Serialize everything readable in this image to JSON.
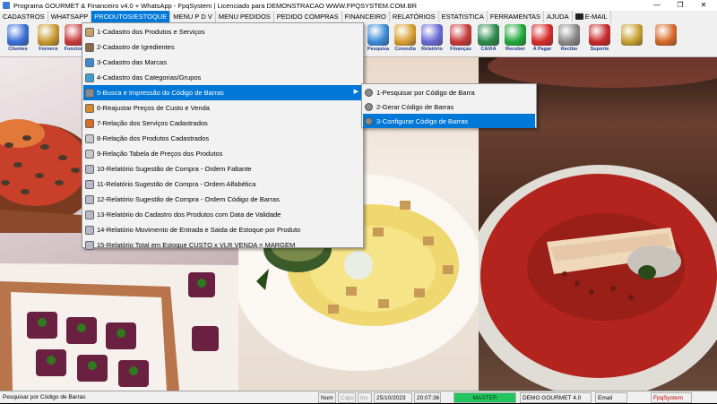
{
  "window": {
    "title": "Programa GOURMET & Financeiro v4.0 + WhatsApp - FpqSystem | Licenciado para  DEMONSTRACAO WWW.FPQSYSTEM.COM.BR",
    "minimize": "—",
    "restore": "❐",
    "close": "✕"
  },
  "menubar": [
    {
      "label": "CADASTROS"
    },
    {
      "label": "WHATSAPP"
    },
    {
      "label": "PRODUTOS/ESTOQUE",
      "active": true
    },
    {
      "label": "MENU P D V"
    },
    {
      "label": "MENU PEDIDOS"
    },
    {
      "label": "PEDIDO COMPRAS"
    },
    {
      "label": "FINANCEIRO"
    },
    {
      "label": "RELATÓRIOS"
    },
    {
      "label": "ESTATISTICA"
    },
    {
      "label": "FERRAMENTAS"
    },
    {
      "label": "AJUDA"
    },
    {
      "label": "E-MAIL",
      "icon": "envelope-icon"
    }
  ],
  "toolbar": [
    {
      "label": "Clientes",
      "icon": "clients-icon",
      "color": "#3a6fd8"
    },
    {
      "label": "Fornece",
      "icon": "suppliers-icon",
      "color": "#c89a30"
    },
    {
      "label": "Funciona",
      "icon": "employees-icon",
      "color": "#c83a3a"
    },
    {
      "label": "Pesquisa",
      "icon": "search-icon",
      "color": "#3a8ad8"
    },
    {
      "label": "Consulta",
      "icon": "consult-icon",
      "color": "#d8a030"
    },
    {
      "label": "Relatório",
      "icon": "report-icon",
      "color": "#6a6ad8"
    },
    {
      "label": "Finanças",
      "icon": "finance-icon",
      "color": "#c83a3a"
    },
    {
      "label": "CAIXA",
      "icon": "cash-register-icon",
      "color": "#2a8a4a"
    },
    {
      "label": "Receber",
      "icon": "receive-icon",
      "color": "#1fa83a"
    },
    {
      "label": "A Pagar",
      "icon": "pay-icon",
      "color": "#d82a2a"
    },
    {
      "label": "Recibo",
      "icon": "receipt-icon",
      "color": "#8a8a8a"
    },
    {
      "label": "Suporte",
      "icon": "support-icon",
      "color": "#c82a2a"
    },
    {
      "label": "",
      "icon": "settings-icon",
      "color": "#c8a030"
    },
    {
      "label": "",
      "icon": "exit-icon",
      "color": "#d86a2a"
    }
  ],
  "dropdown": [
    {
      "label": "1-Cadastro dos Produtos e Serviços",
      "icon": "products-icon",
      "color": "#c8a068"
    },
    {
      "label": "2-Cadastro de Igredientes",
      "icon": "ingredients-icon",
      "color": "#8a6a4a"
    },
    {
      "label": "3-Cadastro das Marcas",
      "icon": "brands-icon",
      "color": "#3a8ad8"
    },
    {
      "label": "4-Cadastro das Categorias/Grupos",
      "icon": "categories-icon",
      "color": "#3aa0d8"
    },
    {
      "label": "5-Busca e Impressão do Código de Barras",
      "icon": "barcode-icon",
      "color": "#8a8a8a",
      "highlight": true,
      "has_submenu": true
    },
    {
      "label": "6-Reajustar Preços de Custo e Venda",
      "icon": "price-adjust-icon",
      "color": "#d88a2a"
    },
    {
      "label": "7-Relação dos Serviços Cadastrados",
      "icon": "services-report-icon",
      "color": "#d86a2a"
    },
    {
      "label": "8-Relação dos Produtos Cadastrados",
      "icon": "products-report-icon",
      "color": "#c8c8c8"
    },
    {
      "label": "9-Relação Tabela de Preços dos Produtos",
      "icon": "price-table-icon",
      "color": "#c8c8c8"
    },
    {
      "label": "10-Relatório Sugestão de Compra - Ordem Faltante",
      "icon": "report-doc-icon",
      "color": "#b8b8c8"
    },
    {
      "label": "11-Relatório Sugestão de Compra - Ordem Alfabética",
      "icon": "report-doc-icon",
      "color": "#b8b8c8"
    },
    {
      "label": "12-Relatório Sugestão de Compra - Ordem Código de Barras",
      "icon": "report-doc-icon",
      "color": "#b8b8c8"
    },
    {
      "label": "13-Relatório do Cadastro dos Produtos com Data de Validade",
      "icon": "report-doc-icon",
      "color": "#b8b8c8"
    },
    {
      "label": "14-Relatório Movimento de Entrada e Saida de Estoque por Produto",
      "icon": "report-doc-icon",
      "color": "#b8b8c8"
    },
    {
      "label": "15-Relatório Total em Estoque CUSTO x VLR VENDA = MARGEM",
      "icon": "report-doc-icon",
      "color": "#b8b8c8"
    }
  ],
  "submenu": [
    {
      "label": "1-Pesquisar por Código de Barra",
      "icon": "disk-icon"
    },
    {
      "label": "2-Gerar Código de Barras",
      "icon": "disk-icon"
    },
    {
      "label": "3-Configurar Código de Barras",
      "icon": "disk-icon",
      "highlight": true
    }
  ],
  "statusbar": {
    "hint": "Pesquisar por Código de Barras",
    "num": "Num",
    "caps": "Caps",
    "ins": "Ins",
    "date": "25/10/2023",
    "time": "20:07:36",
    "mode": "MASTER",
    "company": "DEMO GOURMET 4.0",
    "email": "Email",
    "brand": "FpqSystem"
  }
}
